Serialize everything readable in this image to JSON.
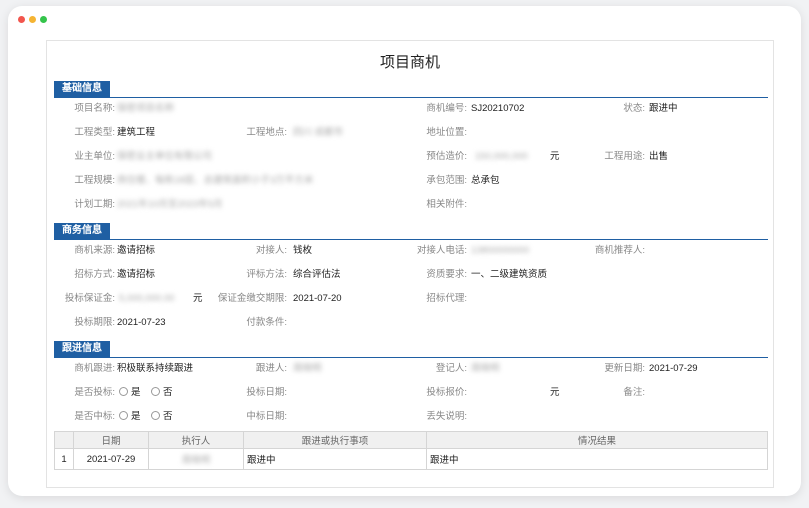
{
  "title": "项目商机",
  "sections": {
    "basic": "基础信息",
    "business": "商务信息",
    "follow": "跟进信息"
  },
  "basic": {
    "project_name_label": "项目名称:",
    "project_name_value": "保密项目名称",
    "opp_no_label": "商机编号:",
    "opp_no_value": "SJ20210702",
    "status_label": "状态:",
    "status_value": "跟进中",
    "eng_type_label": "工程类型:",
    "eng_type_value": "建筑工程",
    "eng_loc_label": "工程地点:",
    "eng_loc_value": "四川 成都市",
    "address_label": "地址位置:",
    "owner_label": "业主单位:",
    "owner_value": "保密业主单位有限公司",
    "est_cost_label": "预估造价:",
    "est_cost_value": "150,000,000",
    "est_cost_unit": "元",
    "eng_use_label": "工程用途:",
    "eng_use_value": "出售",
    "eng_scale_label": "工程规模:",
    "eng_scale_value": "商住楼、每栋18层、总建筑面积小于3万平方米",
    "contract_scope_label": "承包范围:",
    "contract_scope_value": "总承包",
    "plan_period_label": "计划工期:",
    "plan_period_value": "2021年10月至2023年5月",
    "attachments_label": "相关附件:"
  },
  "business": {
    "source_label": "商机来源:",
    "source_value": "邀请招标",
    "contact_label": "对接人:",
    "contact_value": "钱枚",
    "contact_phone_label": "对接人电话:",
    "contact_phone_value": "13800000000",
    "recommender_label": "商机推荐人:",
    "bid_method_label": "招标方式:",
    "bid_method_value": "邀请招标",
    "eval_method_label": "评标方法:",
    "eval_method_value": "综合评估法",
    "qualification_label": "资质要求:",
    "qualification_value": "一、二级建筑资质",
    "deposit_label": "投标保证金:",
    "deposit_value": "5,000,000.00",
    "deposit_unit": "元",
    "deposit_deadline_label": "保证金缴交期限:",
    "deposit_deadline_value": "2021-07-20",
    "agency_label": "招标代理:",
    "bid_deadline_label": "投标期限:",
    "bid_deadline_value": "2021-07-23",
    "payment_label": "付款条件:"
  },
  "follow": {
    "progress_label": "商机跟进:",
    "progress_value": "积极联系持续跟进",
    "follower_label": "跟进人:",
    "follower_value": "周晓明",
    "registrar_label": "登记人:",
    "registrar_value": "周晓明",
    "update_label": "更新日期:",
    "update_value": "2021-07-29",
    "is_bid_label": "是否投标:",
    "yes": "是",
    "no": "否",
    "bid_date_label": "投标日期:",
    "bid_price_label": "投标报价:",
    "bid_price_unit": "元",
    "remark_label": "备注:",
    "is_win_label": "是否中标:",
    "win_date_label": "中标日期:",
    "loss_reason_label": "丢失说明:"
  },
  "table": {
    "headers": [
      "",
      "日期",
      "执行人",
      "跟进或执行事项",
      "情况结果"
    ],
    "rows": [
      {
        "no": "1",
        "date": "2021-07-29",
        "executor": "周晓明",
        "item": "跟进中",
        "result": "跟进中"
      }
    ]
  }
}
